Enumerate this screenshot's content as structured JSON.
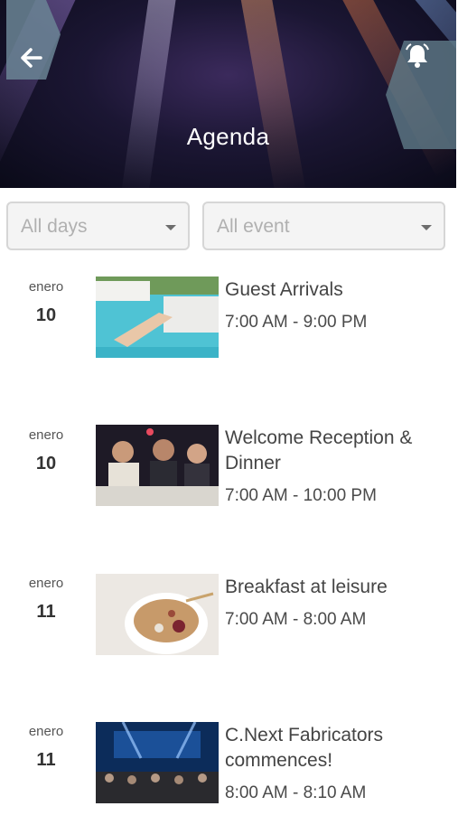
{
  "header": {
    "title": "Agenda",
    "back_icon": "arrow-left-icon",
    "bell_icon": "bell-icon"
  },
  "filters": {
    "days": {
      "value": "All days"
    },
    "events": {
      "value": "All event"
    }
  },
  "events": [
    {
      "month": "enero",
      "day": "10",
      "title": "Guest Arrivals",
      "time": "7:00 AM - 9:00 PM",
      "image": "pool-villa"
    },
    {
      "month": "enero",
      "day": "10",
      "title": "Welcome Reception & Dinner",
      "time": "7:00 AM - 10:00 PM",
      "image": "dinner-party"
    },
    {
      "month": "enero",
      "day": "11",
      "title": "Breakfast at leisure",
      "time": "7:00 AM - 8:00 AM",
      "image": "breakfast-bowl"
    },
    {
      "month": "enero",
      "day": "11",
      "title": " C.Next Fabricators commences!",
      "time": "8:00 AM - 8:10 AM",
      "image": "conference-stage"
    }
  ]
}
